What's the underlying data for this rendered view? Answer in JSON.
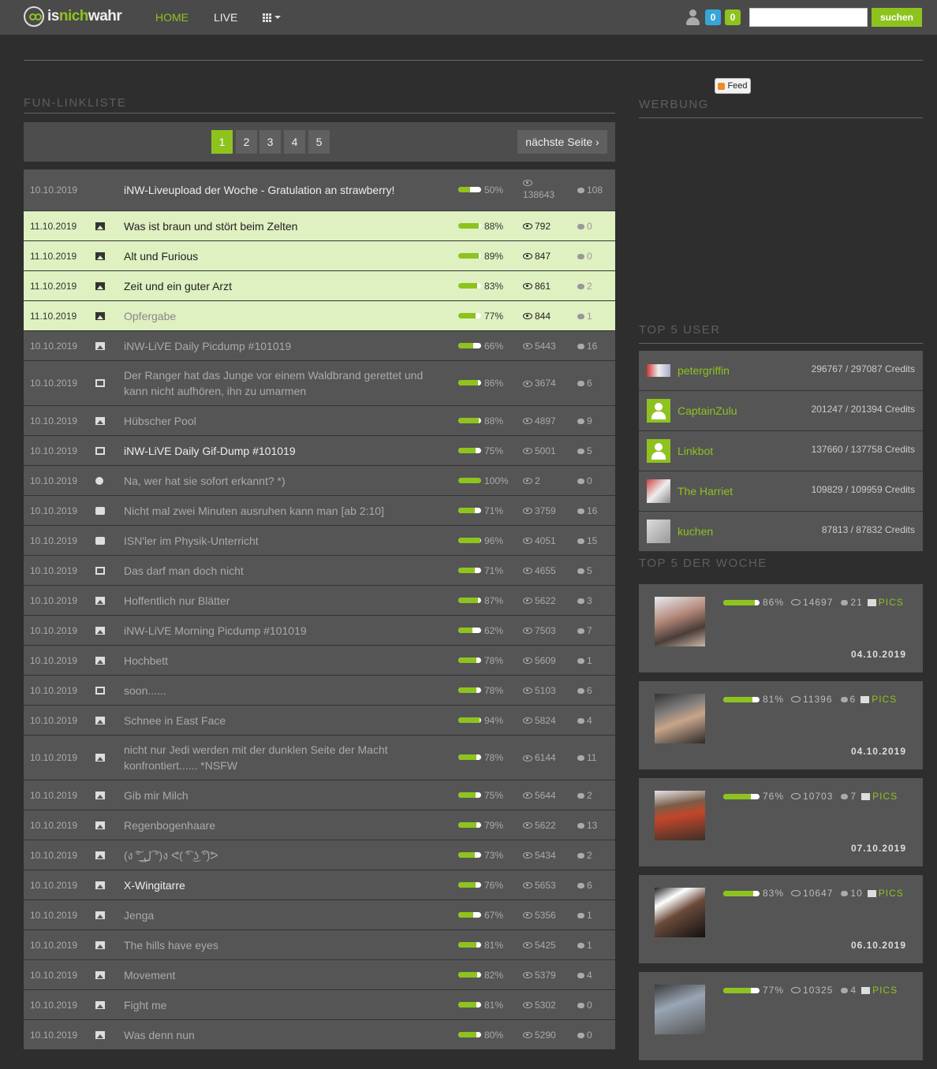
{
  "header": {
    "logo": {
      "part1": "is",
      "part2": "nich",
      "part3": "wahr"
    },
    "nav": [
      {
        "label": "HOME"
      },
      {
        "label": "LIVE"
      }
    ],
    "badge_blue": "0",
    "badge_green": "0",
    "search_placeholder": "",
    "search_button": "suchen",
    "accent": "#8ec31f"
  },
  "feed_label": "Feed",
  "sections": {
    "fun": "FUN-LINKLISTE",
    "werbung": "WERBUNG",
    "top_user": "TOP 5 USER",
    "top_woche": "TOP 5 DER WOCHE"
  },
  "pagination": {
    "pages": [
      "1",
      "2",
      "3",
      "4",
      "5"
    ],
    "current": "1",
    "next": "nächste Seite ›"
  },
  "rows": [
    {
      "date": "10.10.2019",
      "icon": "none",
      "title": "iNW-Liveupload der Woche - Gratulation an strawberry!",
      "rating": 50,
      "rating_label": "50%",
      "views": "138643",
      "comments": "108",
      "style": "bright",
      "h": "tall"
    },
    {
      "date": "11.10.2019",
      "icon": "picture-icon",
      "title": "Was ist braun und stört beim Zelten",
      "rating": 88,
      "rating_label": "88%",
      "views": "792",
      "comments": "0",
      "style": "hl"
    },
    {
      "date": "11.10.2019",
      "icon": "picture-icon",
      "title": "Alt und Furious",
      "rating": 89,
      "rating_label": "89%",
      "views": "847",
      "comments": "0",
      "style": "hl"
    },
    {
      "date": "11.10.2019",
      "icon": "picture-icon",
      "title": "Zeit und ein guter Arzt",
      "rating": 83,
      "rating_label": "83%",
      "views": "861",
      "comments": "2",
      "style": "hl"
    },
    {
      "date": "11.10.2019",
      "icon": "picture-icon",
      "title": "Opfergabe",
      "rating": 77,
      "rating_label": "77%",
      "views": "844",
      "comments": "1",
      "style": "hl-dim"
    },
    {
      "date": "10.10.2019",
      "icon": "picture-icon",
      "title": "iNW-LiVE Daily Picdump #101019",
      "rating": 66,
      "rating_label": "66%",
      "views": "5443",
      "comments": "16"
    },
    {
      "date": "10.10.2019",
      "icon": "film-icon",
      "title": "Der Ranger hat das Junge vor einem Waldbrand gerettet und kann nicht aufhören, ihn zu umarmen",
      "rating": 86,
      "rating_label": "86%",
      "views": "3674",
      "comments": "6",
      "h": "r2"
    },
    {
      "date": "10.10.2019",
      "icon": "picture-icon",
      "title": "Hübscher Pool",
      "rating": 88,
      "rating_label": "88%",
      "views": "4897",
      "comments": "9"
    },
    {
      "date": "10.10.2019",
      "icon": "film-icon",
      "title": "iNW-LiVE Daily Gif-Dump #101019",
      "rating": 75,
      "rating_label": "75%",
      "views": "5001",
      "comments": "5",
      "style": "bright"
    },
    {
      "date": "10.10.2019",
      "icon": "globe-icon",
      "title": "Na, wer hat sie sofort erkannt? *)",
      "rating": 100,
      "rating_label": "100%",
      "views": "2",
      "comments": "0"
    },
    {
      "date": "10.10.2019",
      "icon": "youtube-icon",
      "title": "Nicht mal zwei Minuten ausruhen kann man [ab 2:10]",
      "rating": 71,
      "rating_label": "71%",
      "views": "3759",
      "comments": "16"
    },
    {
      "date": "10.10.2019",
      "icon": "youtube-icon",
      "title": "ISN'ler im Physik-Unterricht",
      "rating": 96,
      "rating_label": "96%",
      "views": "4051",
      "comments": "15"
    },
    {
      "date": "10.10.2019",
      "icon": "film-icon",
      "title": "Das darf man doch nicht",
      "rating": 71,
      "rating_label": "71%",
      "views": "4655",
      "comments": "5"
    },
    {
      "date": "10.10.2019",
      "icon": "picture-icon",
      "title": "Hoffentlich nur Blätter",
      "rating": 87,
      "rating_label": "87%",
      "views": "5622",
      "comments": "3"
    },
    {
      "date": "10.10.2019",
      "icon": "picture-icon",
      "title": "iNW-LiVE Morning Picdump #101019",
      "rating": 62,
      "rating_label": "62%",
      "views": "7503",
      "comments": "7"
    },
    {
      "date": "10.10.2019",
      "icon": "picture-icon",
      "title": "Hochbett",
      "rating": 78,
      "rating_label": "78%",
      "views": "5609",
      "comments": "1"
    },
    {
      "date": "10.10.2019",
      "icon": "film-icon",
      "title": "soon......",
      "rating": 78,
      "rating_label": "78%",
      "views": "5103",
      "comments": "6"
    },
    {
      "date": "10.10.2019",
      "icon": "picture-icon",
      "title": "Schnee in East Face",
      "rating": 94,
      "rating_label": "94%",
      "views": "5824",
      "comments": "4"
    },
    {
      "date": "10.10.2019",
      "icon": "picture-icon",
      "title": "nicht nur Jedi werden mit der dunklen Seite der Macht konfrontiert...... *NSFW",
      "rating": 78,
      "rating_label": "78%",
      "views": "6144",
      "comments": "11",
      "h": "r2"
    },
    {
      "date": "10.10.2019",
      "icon": "picture-icon",
      "title": "Gib mir Milch",
      "rating": 75,
      "rating_label": "75%",
      "views": "5644",
      "comments": "2"
    },
    {
      "date": "10.10.2019",
      "icon": "picture-icon",
      "title": "Regenbogenhaare",
      "rating": 79,
      "rating_label": "79%",
      "views": "5622",
      "comments": "13"
    },
    {
      "date": "10.10.2019",
      "icon": "picture-icon",
      "title": "(ง ͠° ͟ل͜ ͡°)ง ᕙ( ͡° ͜ʖ ͡°)ᕗ",
      "rating": 73,
      "rating_label": "73%",
      "views": "5434",
      "comments": "2"
    },
    {
      "date": "10.10.2019",
      "icon": "picture-icon",
      "title": "X-Wingitarre",
      "rating": 76,
      "rating_label": "76%",
      "views": "5653",
      "comments": "6",
      "style": "bright"
    },
    {
      "date": "10.10.2019",
      "icon": "picture-icon",
      "title": "Jenga",
      "rating": 67,
      "rating_label": "67%",
      "views": "5356",
      "comments": "1"
    },
    {
      "date": "10.10.2019",
      "icon": "picture-icon",
      "title": "The hills have eyes",
      "rating": 81,
      "rating_label": "81%",
      "views": "5425",
      "comments": "1"
    },
    {
      "date": "10.10.2019",
      "icon": "picture-icon",
      "title": "Movement",
      "rating": 82,
      "rating_label": "82%",
      "views": "5379",
      "comments": "4"
    },
    {
      "date": "10.10.2019",
      "icon": "picture-icon",
      "title": "Fight me",
      "rating": 81,
      "rating_label": "81%",
      "views": "5302",
      "comments": "0"
    },
    {
      "date": "10.10.2019",
      "icon": "picture-icon",
      "title": "Was denn nun",
      "rating": 80,
      "rating_label": "80%",
      "views": "5290",
      "comments": "0"
    }
  ],
  "top_users": [
    {
      "name": "petergriffin",
      "credits": "296767 / 297087 Credits",
      "avatar": "p1"
    },
    {
      "name": "CaptainZulu",
      "credits": "201247 / 201394 Credits",
      "avatar": "gen"
    },
    {
      "name": "Linkbot",
      "credits": "137660 / 137758 Credits",
      "avatar": "gen"
    },
    {
      "name": "The Harriet",
      "credits": "109829 / 109959 Credits",
      "avatar": "p2"
    },
    {
      "name": "kuchen",
      "credits": "87813 / 87832 Credits",
      "avatar": "p3"
    }
  ],
  "top_week": [
    {
      "rating": 86,
      "rating_label": "86%",
      "views": "14697",
      "comments": "21",
      "type": "PICS",
      "date": "04.10.2019",
      "thumb": "t1"
    },
    {
      "rating": 81,
      "rating_label": "81%",
      "views": "11396",
      "comments": "6",
      "type": "PICS",
      "date": "04.10.2019",
      "thumb": "t2"
    },
    {
      "rating": 76,
      "rating_label": "76%",
      "views": "10703",
      "comments": "7",
      "type": "PICS",
      "date": "07.10.2019",
      "thumb": "t3"
    },
    {
      "rating": 83,
      "rating_label": "83%",
      "views": "10647",
      "comments": "10",
      "type": "PICS",
      "date": "06.10.2019",
      "thumb": "t4"
    },
    {
      "rating": 77,
      "rating_label": "77%",
      "views": "10325",
      "comments": "4",
      "type": "PICS",
      "date": "",
      "thumb": "t5"
    }
  ]
}
